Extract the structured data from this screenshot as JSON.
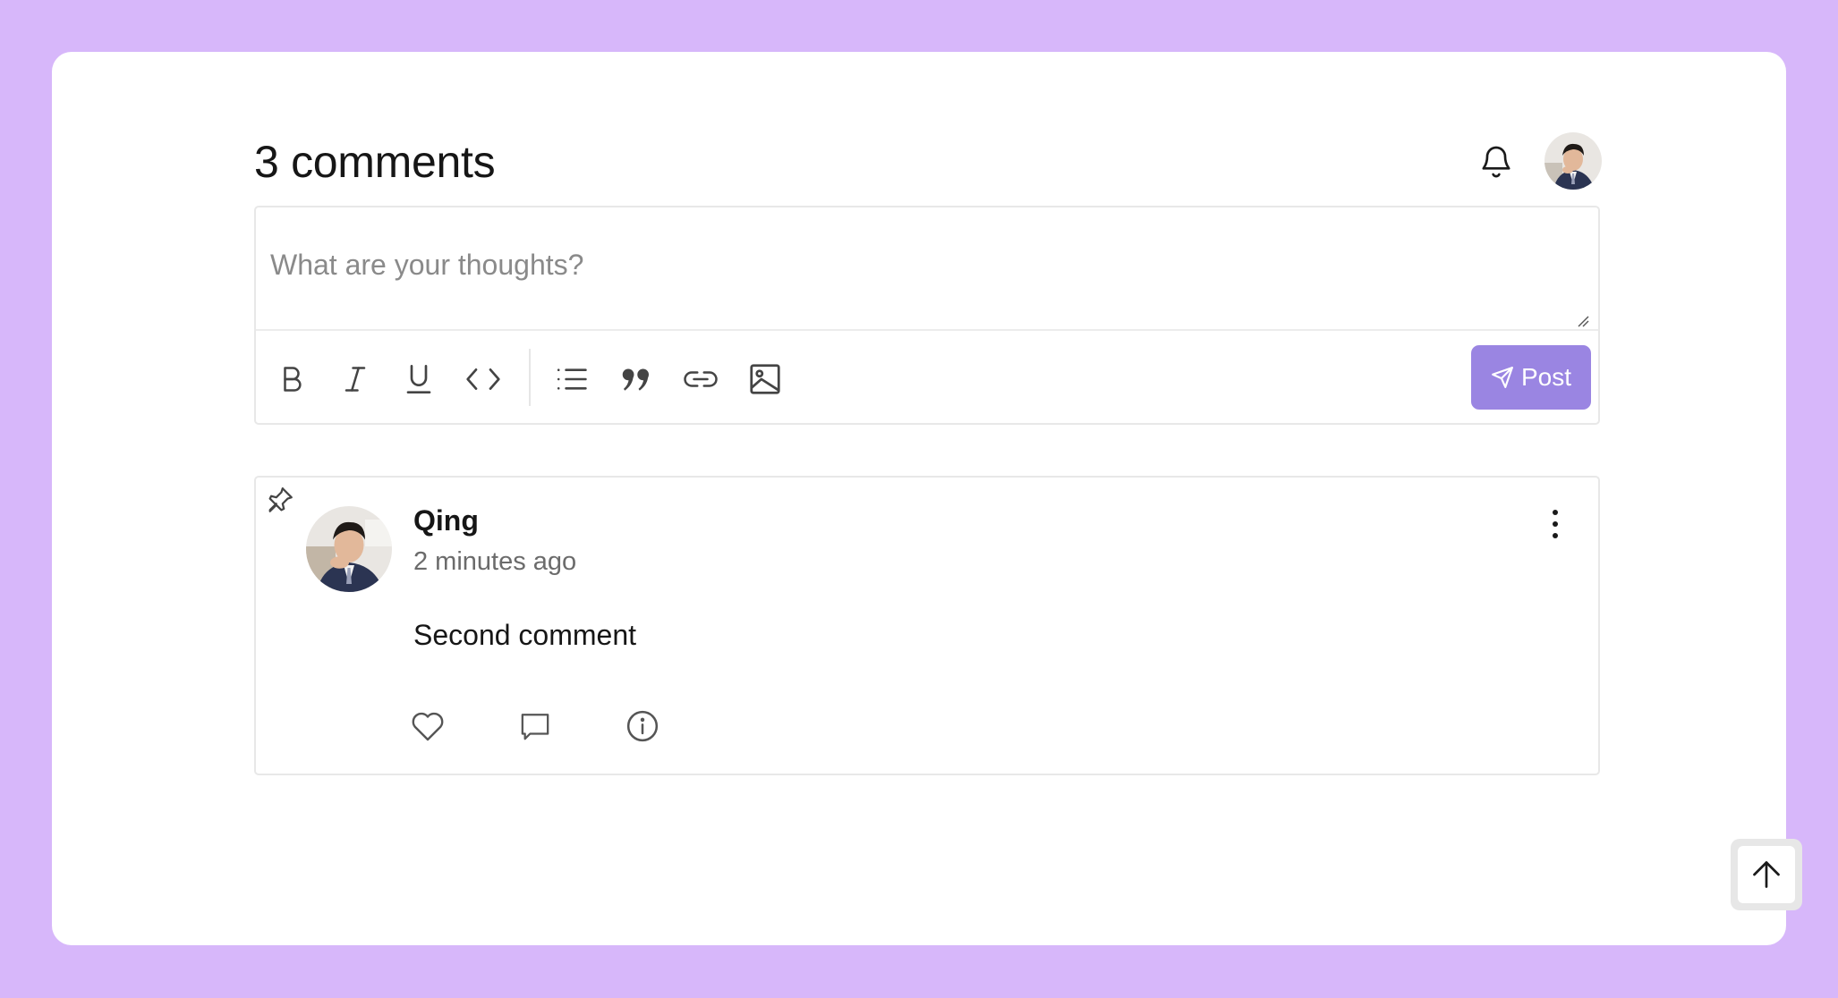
{
  "header": {
    "title": "3 comments",
    "bell_icon": "bell-icon",
    "user_avatar": "user-avatar"
  },
  "editor": {
    "placeholder": "What are your thoughts?",
    "value": "",
    "toolbar": {
      "tools": [
        "bold-icon",
        "italic-icon",
        "underline-icon",
        "code-icon",
        "list-icon",
        "quote-icon",
        "link-icon",
        "image-icon"
      ],
      "post_label": "Post"
    }
  },
  "comments": [
    {
      "pinned": true,
      "author": "Qing",
      "time": "2 minutes ago",
      "text": "Second comment",
      "actions": [
        "like-icon",
        "reply-icon",
        "info-icon"
      ]
    }
  ],
  "colors": {
    "background": "#d7b7fa",
    "accent": "#9a85e2",
    "card": "#ffffff"
  }
}
